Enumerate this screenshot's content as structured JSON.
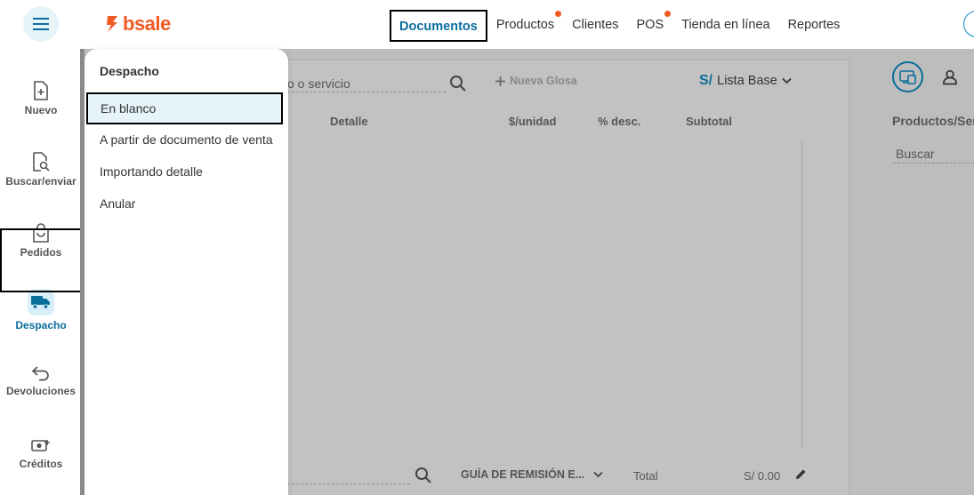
{
  "brand": {
    "name": "bsale",
    "color": "#f15a22",
    "accent": "#0a6e9c"
  },
  "topnav": {
    "menu_icon": "hamburger-icon",
    "items": [
      {
        "label": "Documentos",
        "active": true,
        "dot": false
      },
      {
        "label": "Productos",
        "active": false,
        "dot": true
      },
      {
        "label": "Clientes",
        "active": false,
        "dot": false
      },
      {
        "label": "POS",
        "active": false,
        "dot": true
      },
      {
        "label": "Tienda en línea",
        "active": false,
        "dot": false
      },
      {
        "label": "Reportes",
        "active": false,
        "dot": false
      }
    ]
  },
  "sidebar": {
    "items": [
      {
        "label": "Nuevo",
        "icon": "file-plus-icon"
      },
      {
        "label": "Buscar/enviar",
        "icon": "file-search-icon"
      },
      {
        "label": "Pedidos",
        "icon": "shopping-bag-icon"
      },
      {
        "label": "Despacho",
        "icon": "truck-icon",
        "active": true
      },
      {
        "label": "Devoluciones",
        "icon": "return-arrow-icon"
      },
      {
        "label": "Créditos",
        "icon": "money-plus-icon"
      }
    ]
  },
  "dropdown": {
    "title": "Despacho",
    "items": [
      "En blanco",
      "A partir de documento de venta",
      "Importando detalle",
      "Anular"
    ]
  },
  "document": {
    "search_placeholder": "o o servicio",
    "new_gloss": "Nueva Glosa",
    "currency_symbol": "S/",
    "price_list": "Lista Base",
    "columns": [
      "Detalle",
      "$/unidad",
      "% desc.",
      "Subtotal"
    ],
    "doc_type": "GUÍA DE REMISIÓN E...",
    "total_label": "Total",
    "total_value": "S/ 0.00"
  },
  "right_panel": {
    "title": "Productos/Ser",
    "search_placeholder": "Buscar"
  }
}
